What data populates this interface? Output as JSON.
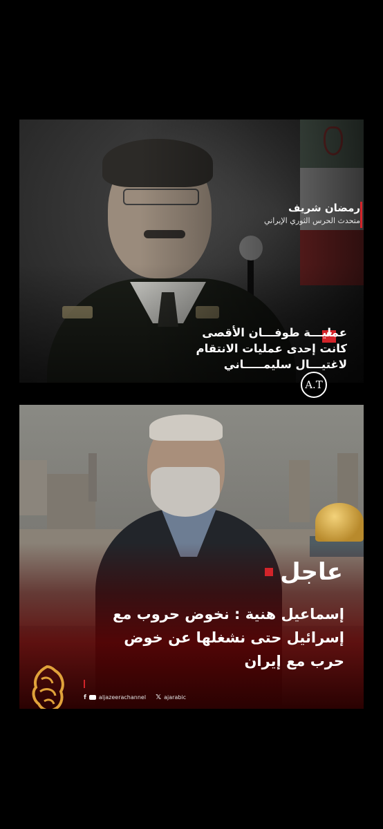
{
  "card1": {
    "speaker_name": "رمضان شريف",
    "speaker_role": "متحدث الحرس الثوري الإيراني",
    "quote_lines": [
      "عمليـــة طوفـــان الأقصى",
      "كانت إحدى عمليات الانتقام",
      "لاغتيـــال سليمـــــاني"
    ],
    "quote_icon": "quote-mark-icon",
    "logo_text": "A.T",
    "accent_color": "#d3242a"
  },
  "card2": {
    "breaking_label": "عاجل",
    "headline_lines": [
      "إسماعيل هنية : نخوض حروب مع",
      "إسرائيل حتى نشغلها عن خوض",
      "حرب مع إيران"
    ],
    "social": {
      "facebook_icon": "f",
      "youtube_icon": "youtube-icon",
      "channel_handle": "aljazeerachannel",
      "x_icon": "𝕏",
      "x_handle": "ajarabic"
    },
    "logo": "aljazeera-logo",
    "accent_color": "#d3242a"
  }
}
